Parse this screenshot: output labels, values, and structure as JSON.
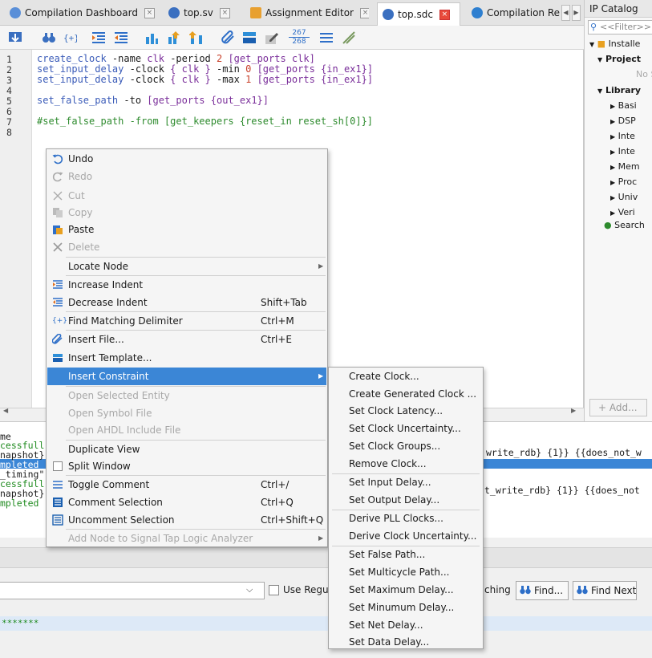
{
  "tabs": [
    {
      "label": "Compilation Dashboard",
      "icon": "dashboard-icon",
      "active": false
    },
    {
      "label": "top.sv",
      "icon": "verilog-file-icon",
      "active": false
    },
    {
      "label": "Assignment Editor",
      "icon": "assignment-editor-icon",
      "active": false
    },
    {
      "label": "top.sdc",
      "icon": "sdc-file-icon",
      "active": true
    },
    {
      "label": "Compilation Rep",
      "icon": "report-icon",
      "active": false
    }
  ],
  "toolbar": {
    "line_count_top": "267",
    "line_count_bottom": "268"
  },
  "editor": {
    "line_numbers": [
      "1",
      "2",
      "3",
      "4",
      "5",
      "6",
      "7",
      "8"
    ],
    "lines": [
      {
        "a": "create_clock",
        "b": " -name ",
        "c": "clk",
        "d": " -period ",
        "e": "2",
        "f": " [get_ports clk]"
      },
      {
        "a": "set_input_delay",
        "b": " -clock ",
        "c": "{ clk }",
        "d": " -min ",
        "e": "0",
        "f": " [get_ports {in_ex1}]"
      },
      {
        "a": "set_input_delay",
        "b": " -clock ",
        "c": "{ clk }",
        "d": " -max ",
        "e": "1",
        "f": " [get_ports {in_ex1}]"
      },
      {
        "a": "",
        "b": "",
        "c": "",
        "d": "",
        "e": "",
        "f": ""
      },
      {
        "a": "set_false_path",
        "b": " -to ",
        "c": "",
        "d": "",
        "e": "",
        "f": "[get_ports {out_ex1}]"
      },
      {
        "a": "",
        "b": "",
        "c": "",
        "d": "",
        "e": "",
        "f": ""
      },
      {
        "a": "#set_false_path -from [get_keepers {reset_in reset_sh[0]}]",
        "b": "",
        "c": "",
        "d": "",
        "e": "",
        "f": ""
      },
      {
        "a": "",
        "b": "",
        "c": "",
        "d": "",
        "e": "",
        "f": ""
      }
    ]
  },
  "ip_catalog": {
    "title": "IP Catalog",
    "filter_placeholder": "<<Filter>>",
    "items": [
      {
        "label": "Installe",
        "bold": false
      },
      {
        "label": "Project",
        "bold": true
      },
      {
        "label": "No S",
        "bold": false
      },
      {
        "label": "Library",
        "bold": true
      },
      {
        "label": "Basi",
        "bold": false
      },
      {
        "label": "DSP",
        "bold": false
      },
      {
        "label": "Inte",
        "bold": false
      },
      {
        "label": "Inte",
        "bold": false
      },
      {
        "label": "Mem",
        "bold": false
      },
      {
        "label": "Proc",
        "bold": false
      },
      {
        "label": "Univ",
        "bold": false
      },
      {
        "label": "Veri",
        "bold": false
      },
      {
        "label": "Search",
        "bold": false
      }
    ],
    "add_button": "+ Add..."
  },
  "messages": [
    {
      "left": "me",
      "right": ""
    },
    {
      "left": "cessfull",
      "right": ""
    },
    {
      "left": "napshot}",
      "right": "write_rdb} {1}} {{does_not_w"
    },
    {
      "left": "mpleted",
      "right": ""
    },
    {
      "left": "_timing\"",
      "right": ""
    },
    {
      "left": "cessfull",
      "right": ""
    },
    {
      "left": "napshot}",
      "right": "t_write_rdb} {1}} {{does_not"
    },
    {
      "left": "mpleted",
      "right": ""
    }
  ],
  "find": {
    "use_regex_label": "Use Regula",
    "matching_label": "ching",
    "find_button": "Find...",
    "find_next_button": "Find Next",
    "stars": "*******"
  },
  "context_menu": [
    {
      "label": "Undo",
      "shortcut": "",
      "disabled": false,
      "icon": "undo-icon"
    },
    {
      "label": "Redo",
      "shortcut": "",
      "disabled": true,
      "icon": "redo-icon"
    },
    {
      "label": "Cut",
      "shortcut": "",
      "disabled": true,
      "icon": "cut-icon"
    },
    {
      "label": "Copy",
      "shortcut": "",
      "disabled": true,
      "icon": "copy-icon"
    },
    {
      "label": "Paste",
      "shortcut": "",
      "disabled": false,
      "icon": "paste-icon"
    },
    {
      "label": "Delete",
      "shortcut": "",
      "disabled": true,
      "icon": "delete-icon"
    },
    {
      "label": "Locate Node",
      "shortcut": "",
      "disabled": false,
      "icon": ""
    },
    {
      "label": "Increase Indent",
      "shortcut": "",
      "disabled": false,
      "icon": "increase-indent-icon"
    },
    {
      "label": "Decrease Indent",
      "shortcut": "Shift+Tab",
      "disabled": false,
      "icon": "decrease-indent-icon"
    },
    {
      "label": "Find Matching Delimiter",
      "shortcut": "Ctrl+M",
      "disabled": false,
      "icon": "delimiter-icon"
    },
    {
      "label": "Insert File...",
      "shortcut": "Ctrl+E",
      "disabled": false,
      "icon": "insert-file-icon"
    },
    {
      "label": "Insert Template...",
      "shortcut": "",
      "disabled": false,
      "icon": "insert-template-icon"
    },
    {
      "label": "Insert Constraint",
      "shortcut": "",
      "disabled": false,
      "icon": ""
    },
    {
      "label": "Open Selected Entity",
      "shortcut": "",
      "disabled": true,
      "icon": ""
    },
    {
      "label": "Open Symbol File",
      "shortcut": "",
      "disabled": true,
      "icon": ""
    },
    {
      "label": "Open AHDL Include File",
      "shortcut": "",
      "disabled": true,
      "icon": ""
    },
    {
      "label": "Duplicate View",
      "shortcut": "",
      "disabled": false,
      "icon": ""
    },
    {
      "label": "Split Window",
      "shortcut": "",
      "disabled": false,
      "icon": "checkbox-icon"
    },
    {
      "label": "Toggle Comment",
      "shortcut": "Ctrl+/",
      "disabled": false,
      "icon": "toggle-comment-icon"
    },
    {
      "label": "Comment Selection",
      "shortcut": "Ctrl+Q",
      "disabled": false,
      "icon": "comment-icon"
    },
    {
      "label": "Uncomment Selection",
      "shortcut": "Ctrl+Shift+Q",
      "disabled": false,
      "icon": "uncomment-icon"
    },
    {
      "label": "Add Node to Signal Tap Logic Analyzer",
      "shortcut": "",
      "disabled": true,
      "icon": ""
    }
  ],
  "submenu": [
    "Create Clock...",
    "Create Generated Clock ...",
    "Set Clock Latency...",
    "Set Clock Uncertainty...",
    "Set Clock Groups...",
    "Remove Clock...",
    "Set Input Delay...",
    "Set Output Delay...",
    "Derive PLL Clocks...",
    "Derive Clock Uncertainty...",
    "Set False Path...",
    "Set Multicycle Path...",
    "Set Maximum Delay...",
    "Set Minumum Delay...",
    "Set Net Delay...",
    "Set Data Delay..."
  ],
  "colors": {
    "accent": "#3b86d6",
    "keyword": "#3a5bb8",
    "comment": "#2e8b2e",
    "number": "#c8402a",
    "close_active": "#e84a3a"
  }
}
